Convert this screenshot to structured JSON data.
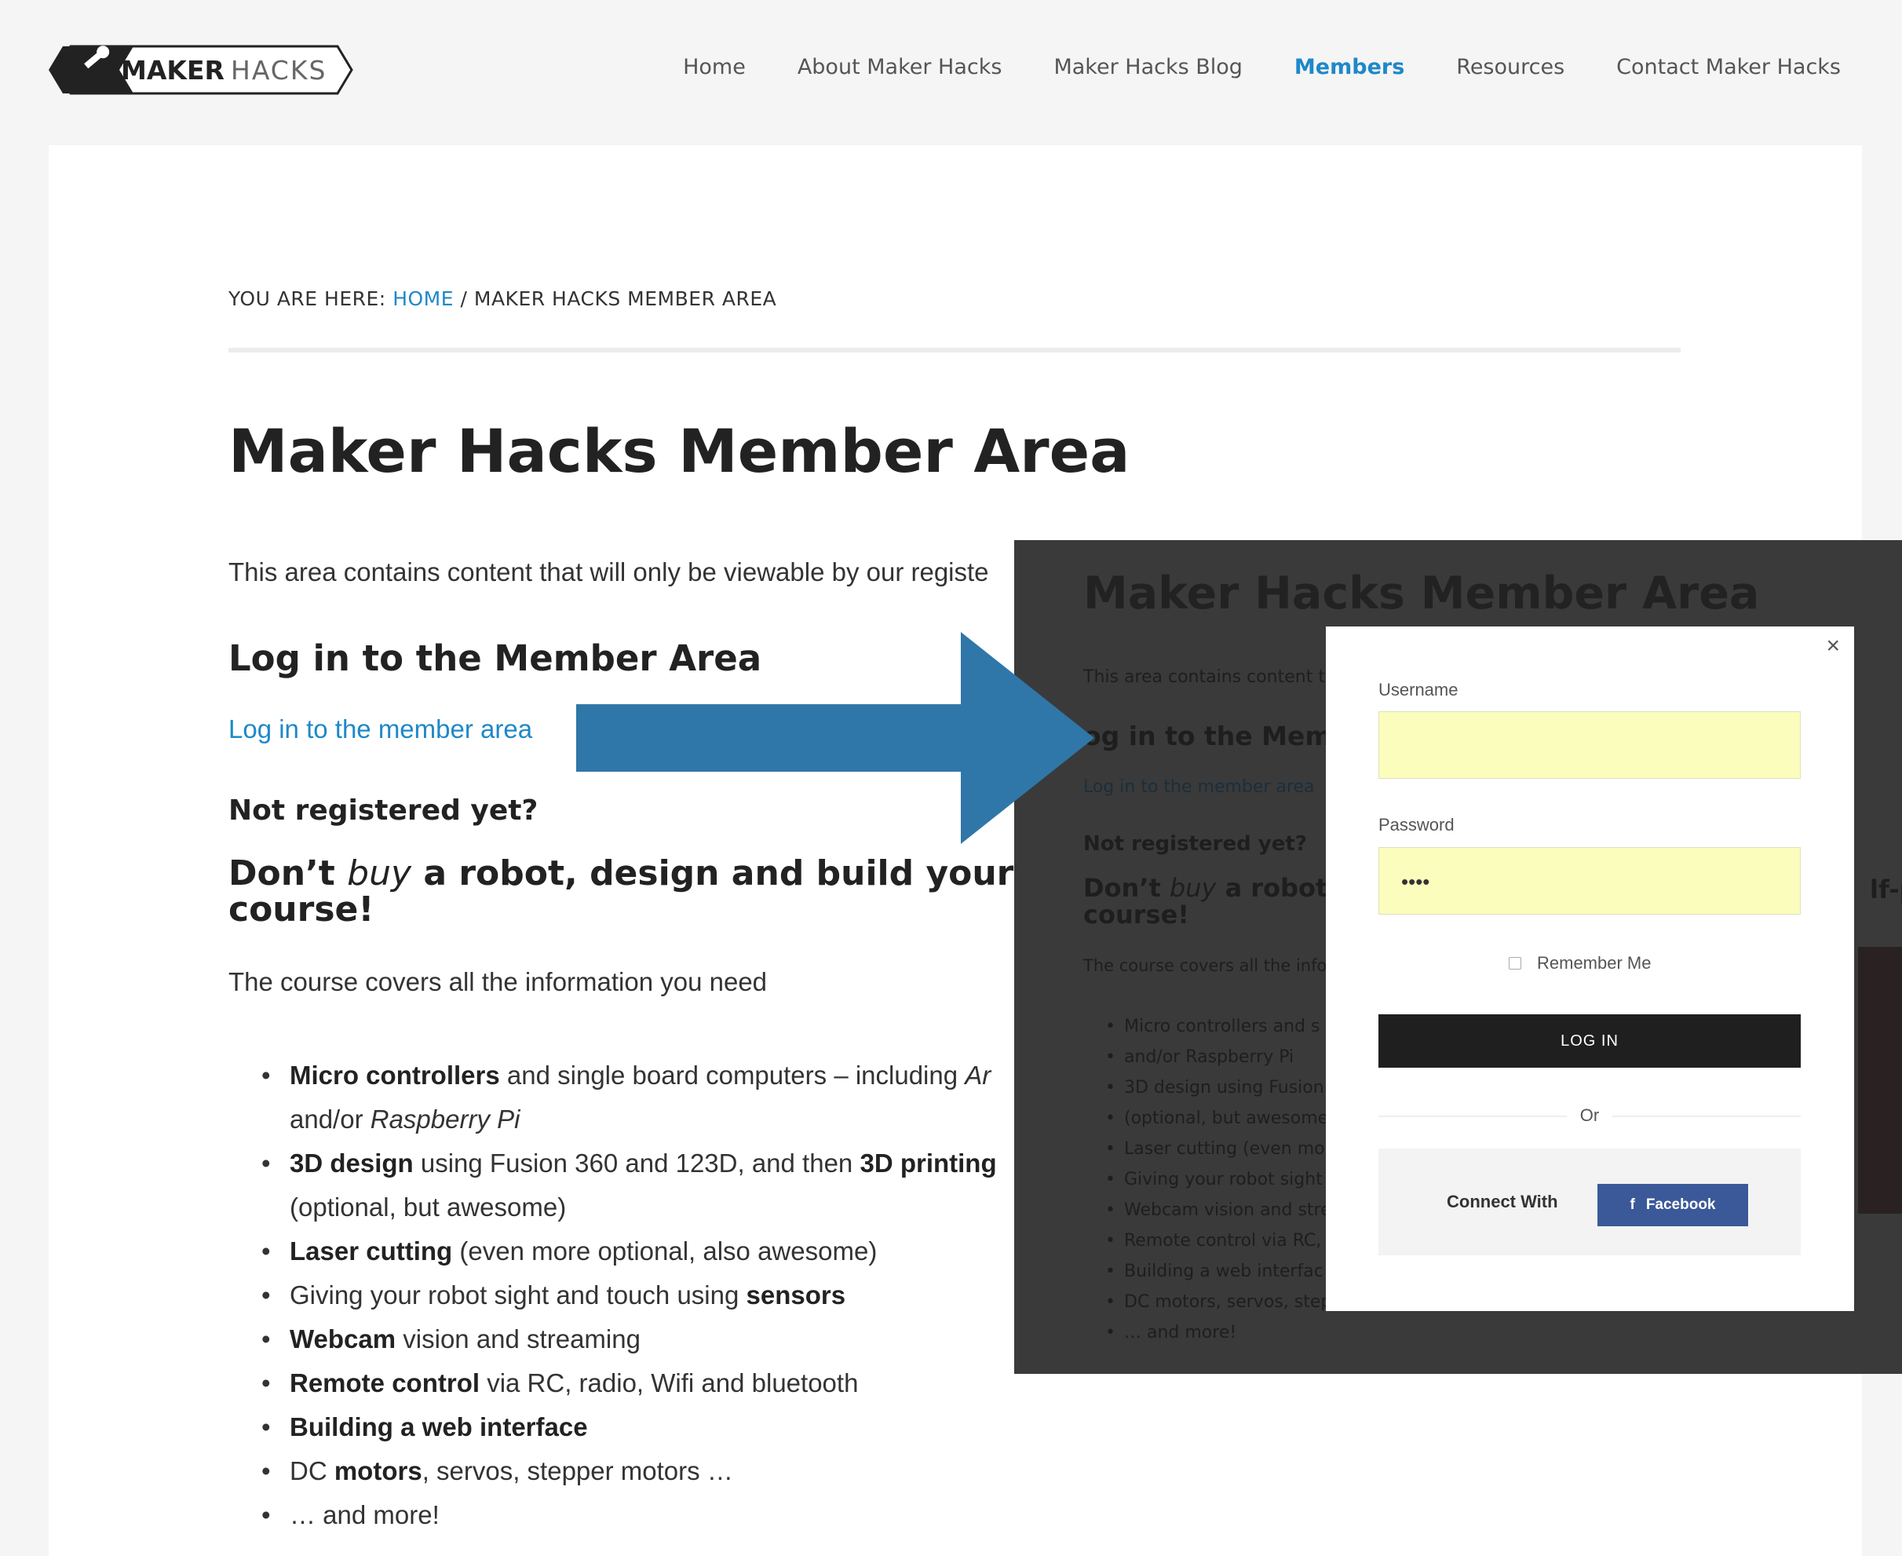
{
  "header": {
    "logo_bold": "MAKER",
    "logo_light": "HACKS",
    "nav": [
      {
        "label": "Home"
      },
      {
        "label": "About Maker Hacks"
      },
      {
        "label": "Maker Hacks Blog"
      },
      {
        "label": "Members",
        "active": true
      },
      {
        "label": "Resources"
      },
      {
        "label": "Contact Maker Hacks"
      }
    ],
    "accent_color": "#1e88c9"
  },
  "breadcrumb": {
    "prefix": "YOU ARE HERE:",
    "home": "HOME",
    "separator": "/",
    "current": "MAKER HACKS MEMBER AREA"
  },
  "page": {
    "title": "Maker Hacks Member Area",
    "intro": "This area contains content that will only be viewable by our registe",
    "login_heading": "Log in to the Member Area",
    "login_link": "Log in to the member area",
    "not_registered": "Not registered yet?",
    "robot_pre": "Don’t ",
    "robot_em": "buy",
    "robot_post": " a robot, design and build your own",
    "robot_line2": "course!",
    "course_intro": "The course covers all the information you need",
    "features": [
      {
        "bold": "Micro controllers",
        "text": " and single board computers – including ",
        "italic": "Ar"
      },
      {
        "text": "and/or ",
        "italic": "Raspberry Pi",
        "continuation": true
      },
      {
        "bold": "3D design",
        "text": " using Fusion 360 and 123D, and then ",
        "bold2": "3D printing"
      },
      {
        "text": "(optional, but awesome)",
        "continuation": true
      },
      {
        "bold": "Laser cutting",
        "text": " (even more optional, also awesome)"
      },
      {
        "text": "Giving your robot sight and touch using ",
        "bold2": "sensors"
      },
      {
        "bold": "Webcam",
        "text": " vision and streaming"
      },
      {
        "bold": "Remote control",
        "text": " via RC, radio, Wifi and bluetooth"
      },
      {
        "bold": "Building a web interface"
      },
      {
        "text": "DC ",
        "bold2": "motors",
        "tail": ", servos, stepper motors …"
      },
      {
        "text": "… and more!"
      }
    ]
  },
  "overlay": {
    "title": "Maker Hacks Member Area",
    "intro": "This area contains content th",
    "login_heading": "og in to the Memb",
    "login_link": "Log in to the member area",
    "not_registered": "Not registered yet?",
    "robot_pre": "Don’t ",
    "robot_em": "buy",
    "robot_post": " a robot, d",
    "robot_line2": "course!",
    "right_fragment": "lf-pa",
    "course_intro": "The course covers all the info",
    "items": [
      "Micro controllers and s",
      "and/or Raspberry Pi",
      "3D design using Fusion",
      "(optional, but awesome)",
      "Laser cutting (even mo",
      "Giving your robot sight a",
      "Webcam vision and stre",
      "Remote control via RC,",
      "Building a web interfac",
      "DC motors, servos, step",
      "… and more!"
    ]
  },
  "modal": {
    "close_glyph": "×",
    "username_label": "Username",
    "username_value": "",
    "password_label": "Password",
    "password_value": "••••",
    "remember_label": "Remember Me",
    "login_button": "LOG IN",
    "or_text": "Or",
    "connect_label": "Connect With",
    "facebook_label": "Facebook",
    "facebook_icon": "f",
    "facebook_color": "#3b5998"
  }
}
